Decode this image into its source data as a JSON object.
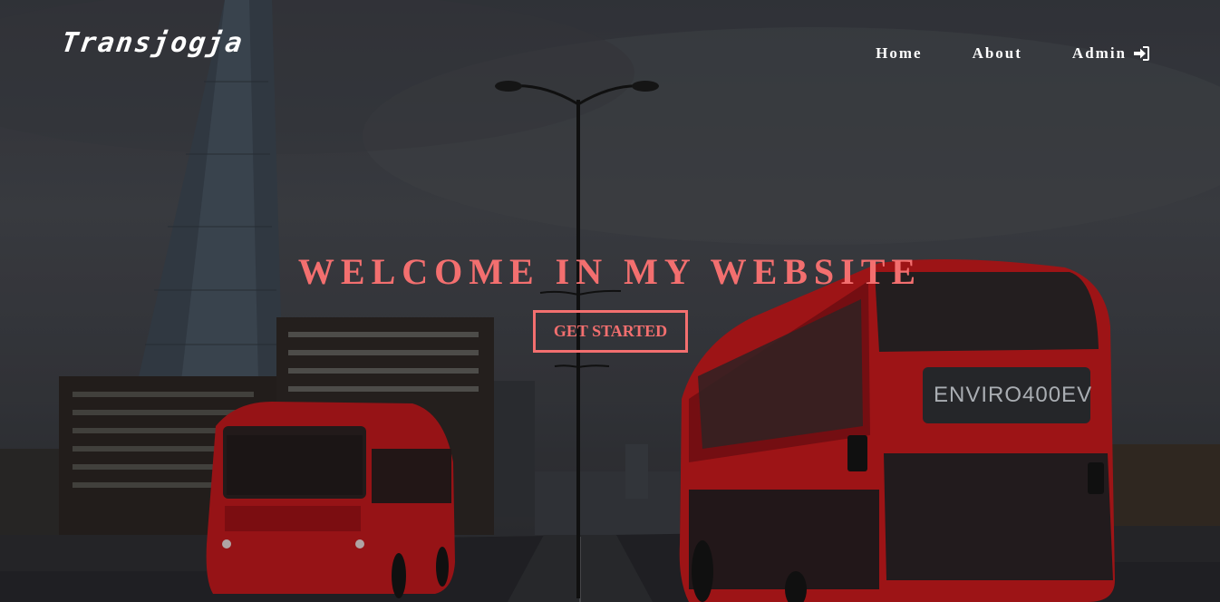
{
  "header": {
    "brand": "Transjogja"
  },
  "nav": {
    "items": [
      {
        "label": "Home"
      },
      {
        "label": "About"
      },
      {
        "label": "Admin"
      }
    ]
  },
  "hero": {
    "title": "WELCOME IN MY WEBSITE",
    "cta_label": "GET STARTED",
    "bus_display": "ENVIRO400EV"
  },
  "colors": {
    "accent": "#f36f6f",
    "nav_text": "#ffffff",
    "bus_red": "#c0191c"
  },
  "icons": {
    "admin": "sign-in-icon"
  }
}
